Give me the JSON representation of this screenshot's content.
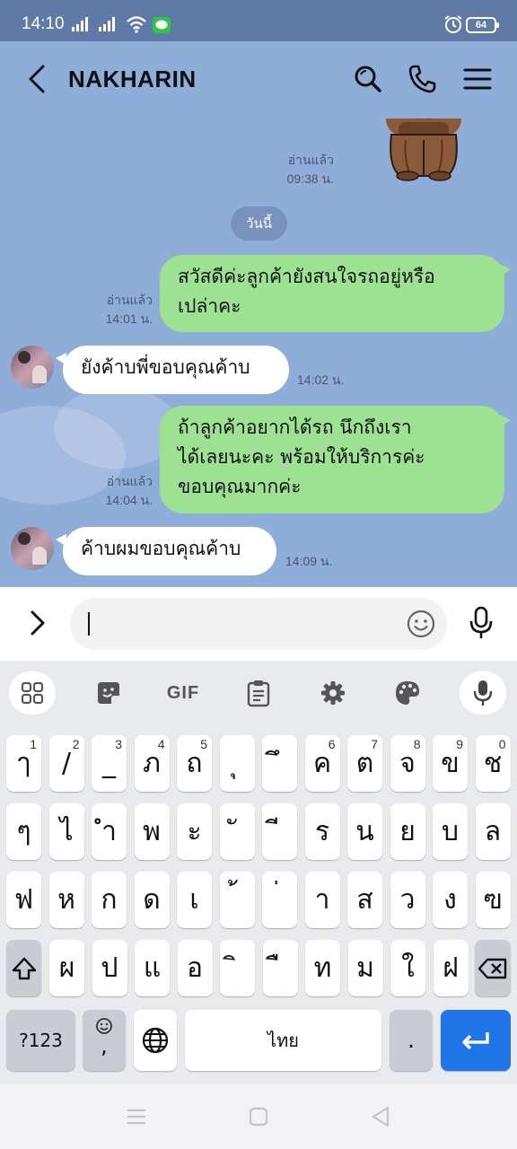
{
  "status_bar": {
    "time": "14:10",
    "line_badge": "LINE",
    "battery": "64"
  },
  "header": {
    "title": "NAKHARIN",
    "back_icon": "chevron-left-icon",
    "search_icon": "search-icon",
    "call_icon": "phone-icon",
    "menu_icon": "hamburger-menu-icon"
  },
  "chat": {
    "sticker_meta": {
      "read": "อ่านแล้ว",
      "time": "09:38 น."
    },
    "date_divider": "วันนี้",
    "messages": [
      {
        "direction": "sent",
        "text": [
          "สวัสดีค่ะลูกค้ายังสนใจรถอยู่หรือ",
          "เปล่าคะ"
        ],
        "read": "อ่านแล้ว",
        "time": "14:01 น."
      },
      {
        "direction": "received",
        "text": [
          "ยังค้าบพี่ขอบคุณค้าบ"
        ],
        "time": "14:02 น."
      },
      {
        "direction": "sent",
        "text": [
          "ถ้าลูกค้าอยากได้รถ นึกถึงเรา",
          "ได้เลยนะคะ พร้อมให้บริการค่ะ",
          "ขอบคุณมากค่ะ"
        ],
        "read": "อ่านแล้ว",
        "time": "14:04 น."
      },
      {
        "direction": "received",
        "text": [
          "ค้าบผมขอบคุณค้าบ"
        ],
        "time": "14:09 น."
      }
    ]
  },
  "input": {
    "value": "",
    "placeholder": ""
  },
  "keyboard": {
    "toolbar": [
      "apps-grid-icon",
      "sticker-icon",
      "GIF",
      "clipboard-icon",
      "settings-gear-icon",
      "palette-icon",
      "microphone-icon"
    ],
    "gif_label": "GIF",
    "rows": [
      [
        {
          "c": "ๅ",
          "h": "1"
        },
        {
          "c": "/",
          "h": "2"
        },
        {
          "c": "_",
          "h": "3"
        },
        {
          "c": "ภ",
          "h": "4"
        },
        {
          "c": "ถ",
          "h": "5"
        },
        {
          "c": "ุ",
          "h": ""
        },
        {
          "c": "ึ",
          "h": ""
        },
        {
          "c": "ค",
          "h": "6"
        },
        {
          "c": "ต",
          "h": "7"
        },
        {
          "c": "จ",
          "h": "8"
        },
        {
          "c": "ข",
          "h": "9"
        },
        {
          "c": "ช",
          "h": "0"
        }
      ],
      [
        {
          "c": "ๆ"
        },
        {
          "c": "ไ"
        },
        {
          "c": "ำ"
        },
        {
          "c": "พ"
        },
        {
          "c": "ะ"
        },
        {
          "c": "ั"
        },
        {
          "c": "ี"
        },
        {
          "c": "ร"
        },
        {
          "c": "น"
        },
        {
          "c": "ย"
        },
        {
          "c": "บ"
        },
        {
          "c": "ล"
        }
      ],
      [
        {
          "c": "ฟ"
        },
        {
          "c": "ห"
        },
        {
          "c": "ก"
        },
        {
          "c": "ด"
        },
        {
          "c": "เ"
        },
        {
          "c": "้"
        },
        {
          "c": "่"
        },
        {
          "c": "า"
        },
        {
          "c": "ส"
        },
        {
          "c": "ว"
        },
        {
          "c": "ง"
        },
        {
          "c": "ฃ"
        }
      ],
      [
        {
          "c": "ผ"
        },
        {
          "c": "ป"
        },
        {
          "c": "แ"
        },
        {
          "c": "อ"
        },
        {
          "c": "ิ"
        },
        {
          "c": "ื"
        },
        {
          "c": "ท"
        },
        {
          "c": "ม"
        },
        {
          "c": "ใ"
        },
        {
          "c": "ฝ"
        }
      ]
    ],
    "mode_key": "?123",
    "emoji_key_comma": ",",
    "space_label": "ไทย",
    "period_key": "."
  },
  "nav": {
    "recents": "recents-icon",
    "home": "home-icon",
    "back": "back-triangle-icon"
  },
  "colors": {
    "chat_bg": "#8fadd9",
    "sent_bubble": "#9de193",
    "received_bubble": "#ffffff",
    "status_bar": "#5f7aa6",
    "enter_key": "#1f74e8"
  }
}
